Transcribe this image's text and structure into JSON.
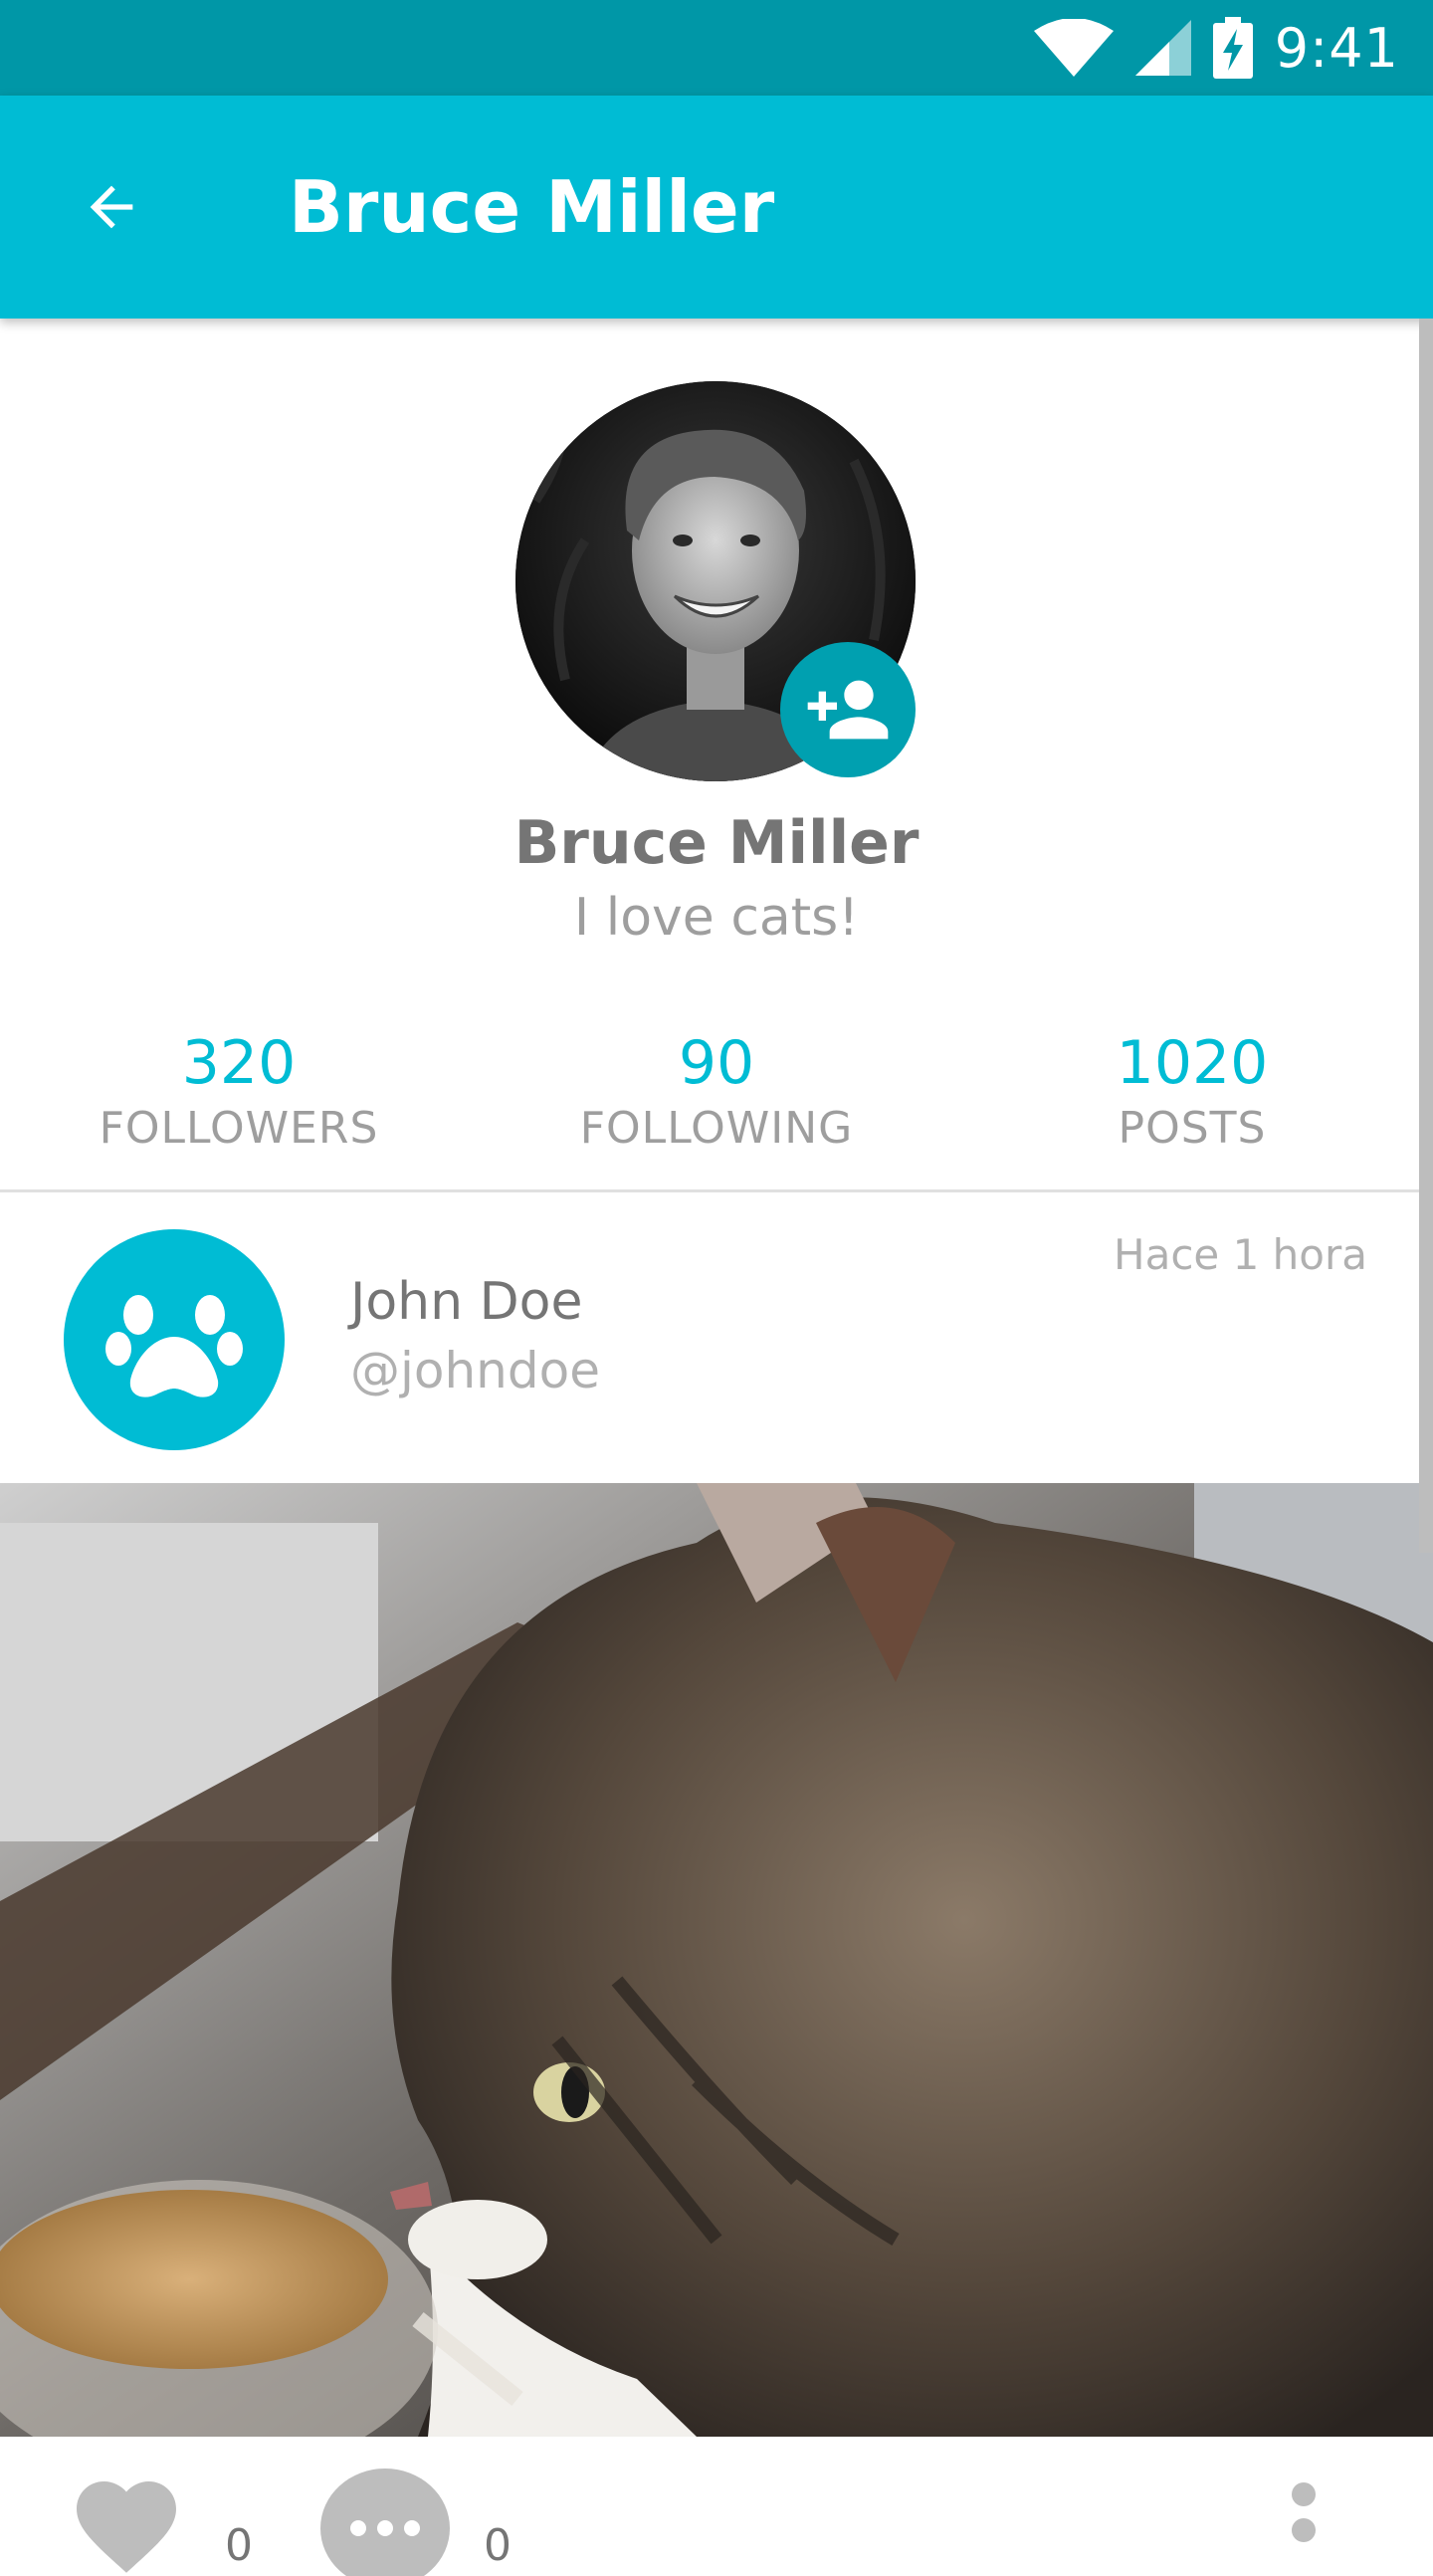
{
  "status_bar": {
    "time": "9:41"
  },
  "app_bar": {
    "title": "Bruce Miller"
  },
  "profile": {
    "name": "Bruce Miller",
    "bio": "I love cats!"
  },
  "stats": [
    {
      "value": "320",
      "label": "FOLLOWERS"
    },
    {
      "value": "90",
      "label": "FOLLOWING"
    },
    {
      "value": "1020",
      "label": "POSTS"
    }
  ],
  "post": {
    "author": "John Doe",
    "handle": "@johndoe",
    "time": "Hace 1 hora",
    "likes": "0",
    "comments": "0"
  },
  "colors": {
    "primary": "#00bcd4",
    "primary_dark": "#0097a7",
    "accent": "#00a0b0"
  },
  "icons": {
    "back": "arrow-back-icon",
    "add_friend": "person-add-icon",
    "paw": "paw-icon",
    "like": "heart-icon",
    "comment": "comment-icon",
    "more": "more-vert-icon"
  }
}
